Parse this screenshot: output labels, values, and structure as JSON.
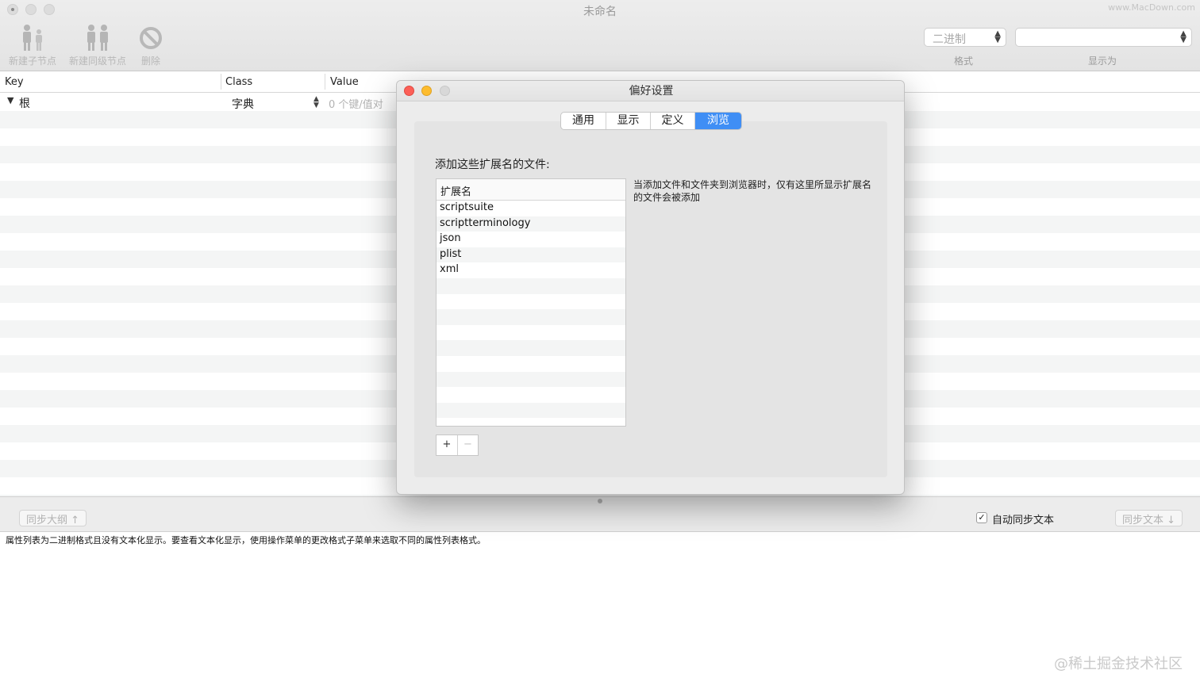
{
  "window": {
    "title": "未命名",
    "watermark_top": "www.MacDown.com"
  },
  "toolbar": {
    "new_child": "新建子节点",
    "new_sibling": "新建同级节点",
    "delete": "删除"
  },
  "format_select": {
    "value": "二进制",
    "label": "格式"
  },
  "display_select": {
    "value": "",
    "label": "显示为"
  },
  "table": {
    "columns": [
      "Key",
      "Class",
      "Value"
    ],
    "root_row": {
      "key": "根",
      "class": "字典",
      "value": "0 个键/值对"
    }
  },
  "bottom_bar": {
    "sync_outline": "同步大纲 ↑",
    "auto_sync_label": "自动同步文本",
    "auto_sync_checked": true,
    "sync_text": "同步文本 ↓"
  },
  "text_view": {
    "message": "属性列表为二进制格式且没有文本化显示。要查看文本化显示，使用操作菜单的更改格式子菜单来选取不同的属性列表格式。"
  },
  "watermark_bottom": "@稀土掘金技术社区",
  "dialog": {
    "title": "偏好设置",
    "tabs": [
      "通用",
      "显示",
      "定义",
      "浏览"
    ],
    "active_tab": "浏览",
    "section_title": "添加这些扩展名的文件:",
    "table_header": "扩展名",
    "extensions": [
      "scriptsuite",
      "scriptterminology",
      "json",
      "plist",
      "xml"
    ],
    "note": "当添加文件和文件夹到浏览器时，仅有这里所显示扩展名的文件会被添加",
    "add_button": "+",
    "remove_button": "−"
  },
  "colors": {
    "accent": "#3f8ef5",
    "close": "#fc5f57",
    "minimize": "#fdbc2e"
  }
}
